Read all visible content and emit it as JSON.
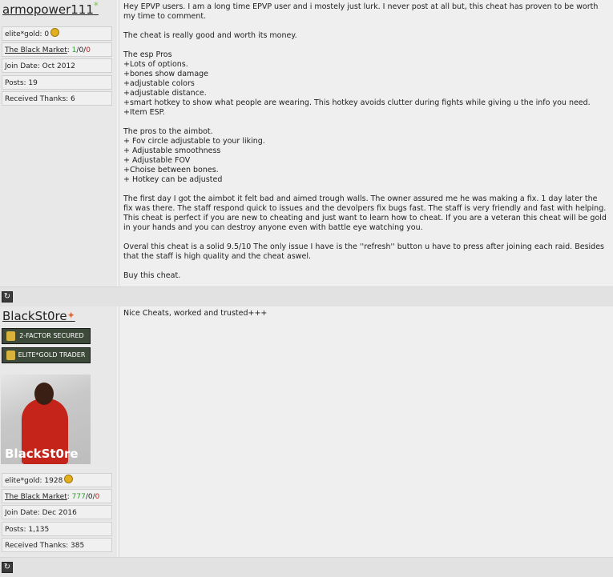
{
  "post1": {
    "username": "armopower111",
    "star": "*",
    "elite_gold_label": "elite*gold: 0",
    "black_market_label": "The Black Market",
    "bm_pos": "1",
    "bm_neu": "0",
    "bm_neg": "0",
    "join_date": "Join Date: Oct 2012",
    "posts": "Posts: 19",
    "thanks": "Received Thanks: 6",
    "text": "Hey EPVP users. I am a long time EPVP user and i mostely just lurk. I never post at all but, this cheat has proven to be worth my time to comment.\n\nThe cheat is really good and worth its money.\n\nThe esp Pros\n+Lots of options.\n+bones show damage\n+adjustable colors\n+adjustable distance.\n+smart hotkey to show what people are wearing. This hotkey avoids clutter during fights while giving u the info you need.\n+Item ESP.\n\nThe pros to the aimbot.\n+ Fov circle adjustable to your liking.\n+ Adjustable smoothness\n+ Adjustable FOV\n+Choise between bones.\n+ Hotkey can be adjusted\n\nThe first day I got the aimbot it felt bad and aimed trough walls. The owner assured me he was making a fix. 1 day later the fix was there. The staff respond quick to issues and the devolpers fix bugs fast. The staff is very friendly and fast with helping. This cheat is perfect if you are new to cheating and just want to learn how to cheat. If you are a veteran this cheat will be gold in your hands and you can destroy anyone even with battle eye watching you.\n\nOveral this cheat is a solid 9.5/10 The only issue I have is the ''refresh'' button u have to press after joining each raid. Besides that the staff is high quality and the cheat aswel.\n\nBuy this cheat."
  },
  "post2": {
    "username": "BlackSt0re",
    "badge1": "2-FACTOR SECURED",
    "badge2": "ELITE*GOLD TRADER",
    "avatar_text": "BlackSt0re",
    "elite_gold_label": "elite*gold: 1928",
    "black_market_label": "The Black Market",
    "bm_pos": "777",
    "bm_neu": "0",
    "bm_neg": "0",
    "join_date": "Join Date: Dec 2016",
    "posts": "Posts: 1,135",
    "thanks": "Received Thanks: 385",
    "text": "Nice Cheats, worked and trusted+++"
  },
  "icons": {
    "refresh": "refresh-icon",
    "gold": "gold-coin-icon",
    "lock": "lock-icon",
    "rank": "rank-icon",
    "star": "star-icon"
  }
}
